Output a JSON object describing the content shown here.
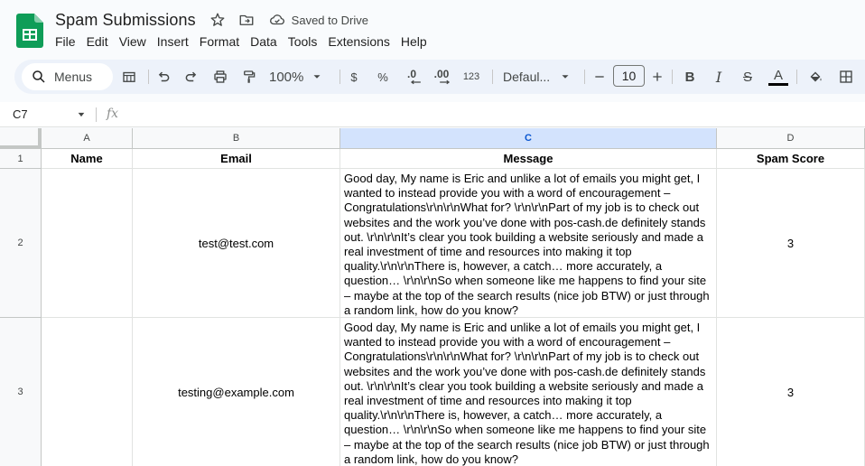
{
  "app": {
    "title": "Spam Submissions",
    "save_status": "Saved to Drive",
    "brand_color": "#0f9d58"
  },
  "menu": [
    "File",
    "Edit",
    "View",
    "Insert",
    "Format",
    "Data",
    "Tools",
    "Extensions",
    "Help"
  ],
  "toolbar": {
    "search_label": "Menus",
    "zoom": "100%",
    "currency": "$",
    "percent": "%",
    "decrease_decimals": ".0",
    "increase_decimals": ".00",
    "number_format": "123",
    "font": "Defaul...",
    "font_size": "10",
    "bold": "B",
    "italic": "I",
    "strikethrough": "S",
    "text_color": "A"
  },
  "formula_bar": {
    "cell_ref": "C7",
    "fx": "fx",
    "value": ""
  },
  "grid": {
    "columns": [
      "A",
      "B",
      "C",
      "D"
    ],
    "selected_column": "C",
    "row_numbers": [
      "1",
      "2",
      "3"
    ],
    "header_row": [
      "Name",
      "Email",
      "Message",
      "Spam Score"
    ],
    "rows": [
      {
        "name": "",
        "email": "test@test.com",
        "message": "Good day, My name is Eric and unlike a lot of emails you might get, I wanted to instead provide you with a word of encouragement – Congratulations\\r\\n\\r\\nWhat for? \\r\\n\\r\\nPart of my job is to check out websites and the work you’ve done with pos-cash.de definitely stands out. \\r\\n\\r\\nIt’s clear you took building a website seriously and made a real investment of time and resources into making it top quality.\\r\\n\\r\\nThere is, however, a catch… more accurately, a question… \\r\\n\\r\\nSo when someone like me happens to find your site – maybe at the top of the search results (nice job BTW) or just through a random link, how do you know?",
        "spam_score": "3"
      },
      {
        "name": "",
        "email": "testing@example.com",
        "message": "Good day, My name is Eric and unlike a lot of emails you might get, I wanted to instead provide you with a word of encouragement – Congratulations\\r\\n\\r\\nWhat for? \\r\\n\\r\\nPart of my job is to check out websites and the work you’ve done with pos-cash.de definitely stands out. \\r\\n\\r\\nIt’s clear you took building a website seriously and made a real investment of time and resources into making it top quality.\\r\\n\\r\\nThere is, however, a catch… more accurately, a question… \\r\\n\\r\\nSo when someone like me happens to find your site – maybe at the top of the search results (nice job BTW) or just through a random link, how do you know?",
        "spam_score": "3"
      }
    ]
  }
}
